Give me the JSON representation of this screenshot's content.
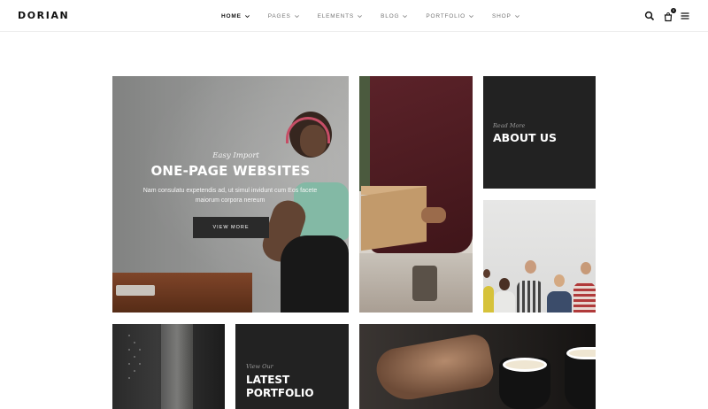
{
  "header": {
    "logo": "DORIAN",
    "nav": [
      {
        "label": "HOME"
      },
      {
        "label": "PAGES"
      },
      {
        "label": "ELEMENTS"
      },
      {
        "label": "BLOG"
      },
      {
        "label": "PORTFOLIO"
      },
      {
        "label": "SHOP"
      }
    ],
    "cart_count": "0",
    "icons": [
      "search-icon",
      "cart-icon",
      "menu-icon"
    ]
  },
  "tiles": {
    "hero": {
      "kicker": "Easy Import",
      "title": "ONE-PAGE WEBSITES",
      "description": "Nam consulatu expetendis ad, ut simul invidunt cum Eos facete maiorum corpora nereum",
      "button": "VIEW MORE"
    },
    "about": {
      "kicker": "Read More",
      "title": "ABOUT US"
    },
    "portfolio": {
      "kicker": "View Our",
      "title_line1": "LATEST",
      "title_line2": "PORTFOLIO"
    }
  },
  "colors": {
    "dark_tile": "#222222",
    "button": "#2a2a2a",
    "text_dark": "#111111"
  }
}
